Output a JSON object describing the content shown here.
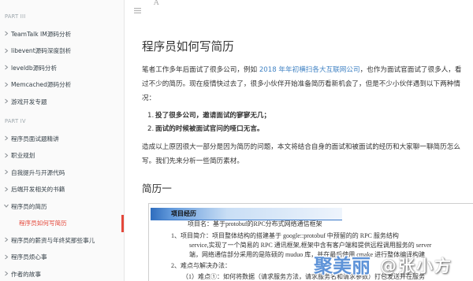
{
  "theme": {
    "active_color": "#e4483b",
    "link_color": "#4183c4",
    "sidebar_background": "#fafafa",
    "resume_band_color": "#2f6dbd"
  },
  "toolbar": {
    "menu_icon": "hamburger-menu-icon",
    "font_icon": "font-settings-icon",
    "font_glyph": "A"
  },
  "sidebar": {
    "items": [
      {
        "kind": "part",
        "label": "PART III"
      },
      {
        "kind": "item",
        "label": "TeamTalk IM源码分析",
        "icon": "chevron-right-icon"
      },
      {
        "kind": "item",
        "label": "libevent源码深度剖析",
        "icon": "chevron-right-icon"
      },
      {
        "kind": "item",
        "label": "leveldb源码分析",
        "icon": "chevron-right-icon"
      },
      {
        "kind": "item",
        "label": "Memcached源码分析",
        "icon": "chevron-right-icon"
      },
      {
        "kind": "item",
        "label": "游戏开发专题",
        "icon": "chevron-right-icon"
      },
      {
        "kind": "part",
        "label": "PART IV"
      },
      {
        "kind": "item",
        "label": "程序员面试题精讲",
        "icon": "chevron-right-icon"
      },
      {
        "kind": "item",
        "label": "职业规划",
        "icon": "chevron-right-icon"
      },
      {
        "kind": "item",
        "label": "自我提升与开源代码",
        "icon": "chevron-right-icon"
      },
      {
        "kind": "item",
        "label": "后端开发相关的书籍",
        "icon": "chevron-right-icon"
      },
      {
        "kind": "item",
        "label": "程序员的简历",
        "icon": "chevron-down-icon",
        "expanded": true
      },
      {
        "kind": "child",
        "label": "程序员如何写简历",
        "active": true
      },
      {
        "kind": "item",
        "label": "程序员的薪资与年终奖那些事儿",
        "icon": "chevron-right-icon"
      },
      {
        "kind": "item",
        "label": "程序员烦心事",
        "icon": "chevron-right-icon"
      },
      {
        "kind": "item",
        "label": "作者的故事",
        "icon": "chevron-right-icon"
      }
    ]
  },
  "article": {
    "title": "程序员如何写简历",
    "intro": {
      "line1_before": "笔者工作多年后面试了很多公司，例如 ",
      "line1_link": "2018 年年初横扫各大互联网公司",
      "line1_after": "，也作为面试官面试了很多人，看",
      "line2": "过不少的简历。现在疫情快过去了，很多小伙伴开始准备简历看新机会了，但是不少小伙伴遇到以下两种情",
      "line3": "况："
    },
    "list": [
      {
        "num": "1.",
        "text": "投了很多公司，邀请面试的寥寥无几；"
      },
      {
        "num": "2.",
        "text": "面试的时候被面试官问的哑口无言。"
      }
    ],
    "para2": {
      "line1": "造成以上原因很大一部分是因为简历的问题，本文将结合自身的面试和被面试的经历和大家聊一聊简历怎么",
      "line2": "写。我们先来分析一些简历素材。"
    },
    "heading": "简历一",
    "resume_image": {
      "section_title": "项目经历",
      "lines": [
        "项目名：基于protobuf的RPC分布式网络通信框架",
        "1、项目简介：项目整体结构的搭建基于 google::protobuf 中预留的的 RPC 服务结构",
        "service,实现了一个简易的 RPC 通讯框架,框架中含有客户端和提供远程调用服务的 server",
        "端，网络通信部分采用的是陈硕的 muduo 库，并在最后使用 cmake 进行整体编译构建",
        "2、难点与解决办法：",
        "（1）难点①：如何将数据（请求服务方法，请求服务名和请求参数）打包发送并在服务"
      ]
    }
  },
  "watermark": {
    "site": "聚美丽",
    "handle": "@张小方"
  }
}
